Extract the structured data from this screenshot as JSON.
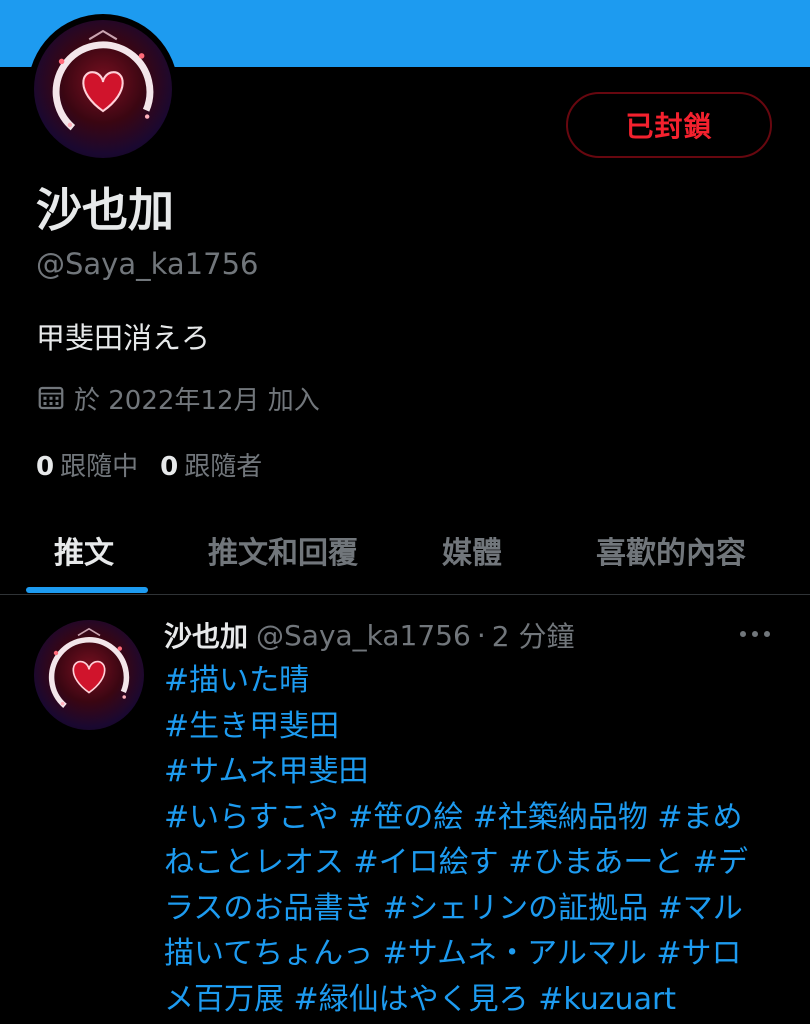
{
  "profile": {
    "name": "沙也加",
    "handle": "@Saya_ka1756",
    "bio": "甲斐田消えろ",
    "joined": "於 2022年12月 加入",
    "following_count": "0",
    "following_label": "跟隨中",
    "followers_count": "0",
    "followers_label": "跟隨者",
    "blocked_label": "已封鎖"
  },
  "tabs": [
    {
      "label": "推文"
    },
    {
      "label": "推文和回覆"
    },
    {
      "label": "媒體"
    },
    {
      "label": "喜歡的內容"
    }
  ],
  "tweet": {
    "name": "沙也加",
    "handle": "@Saya_ka1756",
    "separator": "·",
    "time": "2 分鐘",
    "lines": [
      "#描いた晴",
      "#生き甲斐田",
      "#サムネ甲斐田",
      "#いらすこや #笹の絵 #社築納品物 #まめ",
      "ねことレオス #イロ絵す #ひまあーと #デ",
      "ラスのお品書き #シェリンの証拠品 #マル",
      "描いてちょんっ #サムネ・アルマル #サロ",
      "メ百万展 #緑仙はやく見ろ #kuzuart"
    ]
  },
  "colors": {
    "accent": "#1d9bf0",
    "blocked_red": "#f4212e",
    "secondary_text": "#71767b",
    "primary_text": "#e7e9ea",
    "background": "#000000"
  },
  "icons": {
    "joined": "calendar-icon",
    "more": "more-horizontal-icon"
  }
}
